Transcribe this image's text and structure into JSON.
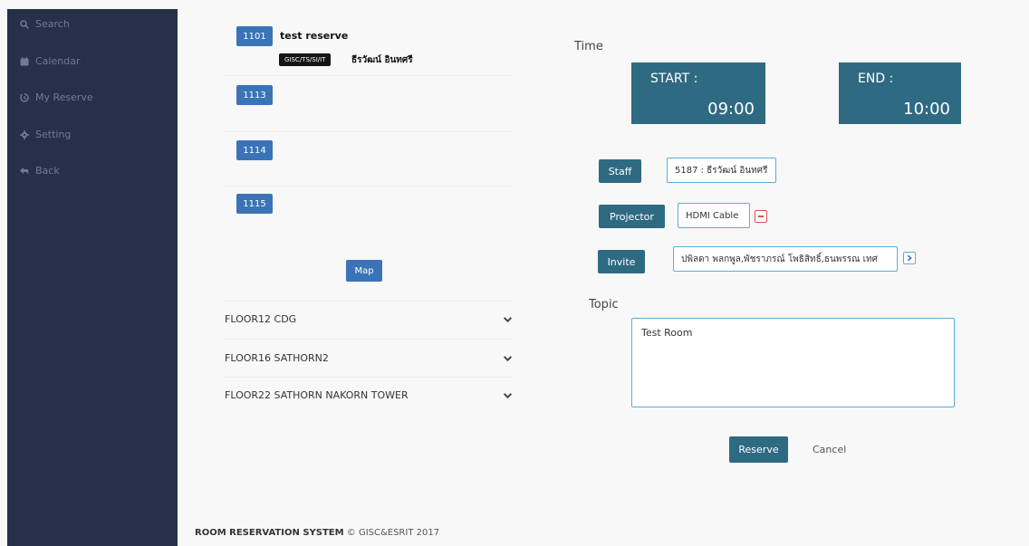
{
  "sidebar": {
    "items": [
      {
        "label": "Search",
        "icon": "search-icon"
      },
      {
        "label": "Calendar",
        "icon": "calendar-icon"
      },
      {
        "label": "My Reserve",
        "icon": "history-icon"
      },
      {
        "label": "Setting",
        "icon": "gear-icon"
      },
      {
        "label": "Back",
        "icon": "reply-icon"
      }
    ]
  },
  "rooms": [
    {
      "number": "1101",
      "booking": {
        "title": "test reserve",
        "department": "GISC/TS/SI/IT",
        "staff": "ธีรวัฒน์ อินทศรี"
      }
    },
    {
      "number": "1113"
    },
    {
      "number": "1114"
    },
    {
      "number": "1115"
    }
  ],
  "map_button": "Map",
  "floors": [
    "FLOOR12 CDG",
    "FLOOR16 SATHORN2",
    "FLOOR22 SATHORN NAKORN TOWER"
  ],
  "footer": {
    "brand": "ROOM RESERVATION SYSTEM",
    "copyright": "© GISC&ESRIT 2017"
  },
  "time": {
    "label": "Time",
    "start_label": "START :",
    "start_value": "09:00",
    "end_label": "END :",
    "end_value": "10:00"
  },
  "form": {
    "staff_label": "Staff",
    "staff_value": "5187 : ธีรวัฒน์ อินทศรี",
    "projector_label": "Projector",
    "projector_value": "HDMI Cable",
    "invite_label": "Invite",
    "invite_value": "ปพิลดา พลกพูล,พัชราภรณ์ โพธิสิทธิ์,ธนพรรณ เทศ",
    "topic_label": "Topic",
    "topic_value": "Test Room"
  },
  "actions": {
    "reserve": "Reserve",
    "cancel": "Cancel"
  },
  "colors": {
    "sidebar": "#27304a",
    "room_badge": "#3a73b7",
    "teal": "#2f6a83",
    "input_border": "#5aaed6",
    "remove": "#d9534f"
  }
}
